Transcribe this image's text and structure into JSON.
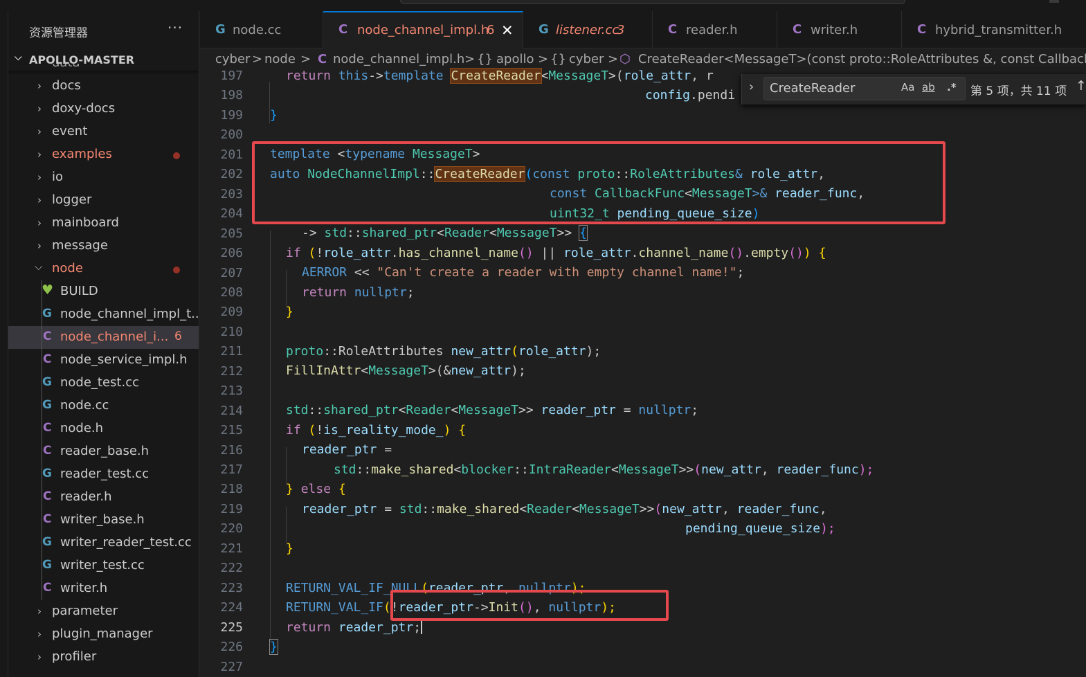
{
  "explorer": {
    "title": "资源管理器",
    "more": "···",
    "root": "APOLLO-MASTER",
    "partial_top": "data",
    "items": [
      {
        "label": "docs",
        "kind": "folder",
        "expanded": false
      },
      {
        "label": "doxy-docs",
        "kind": "folder",
        "expanded": false
      },
      {
        "label": "event",
        "kind": "folder",
        "expanded": false
      },
      {
        "label": "examples",
        "kind": "folder",
        "expanded": false,
        "modified": true
      },
      {
        "label": "io",
        "kind": "folder",
        "expanded": false
      },
      {
        "label": "logger",
        "kind": "folder",
        "expanded": false
      },
      {
        "label": "mainboard",
        "kind": "folder",
        "expanded": false
      },
      {
        "label": "message",
        "kind": "folder",
        "expanded": false
      },
      {
        "label": "node",
        "kind": "folder",
        "expanded": true,
        "modified": true
      }
    ],
    "node_files": [
      {
        "label": "BUILD",
        "icon": "heart"
      },
      {
        "label": "node_channel_impl_t...",
        "icon": "cpp"
      },
      {
        "label": "node_channel_i...",
        "icon": "c",
        "active": true,
        "badge": "6"
      },
      {
        "label": "node_service_impl.h",
        "icon": "c"
      },
      {
        "label": "node_test.cc",
        "icon": "cpp"
      },
      {
        "label": "node.cc",
        "icon": "cpp"
      },
      {
        "label": "node.h",
        "icon": "c"
      },
      {
        "label": "reader_base.h",
        "icon": "c"
      },
      {
        "label": "reader_test.cc",
        "icon": "cpp"
      },
      {
        "label": "reader.h",
        "icon": "c"
      },
      {
        "label": "writer_base.h",
        "icon": "c"
      },
      {
        "label": "writer_reader_test.cc",
        "icon": "cpp"
      },
      {
        "label": "writer_test.cc",
        "icon": "cpp"
      },
      {
        "label": "writer.h",
        "icon": "c"
      }
    ],
    "after_items": [
      {
        "label": "parameter"
      },
      {
        "label": "plugin_manager"
      },
      {
        "label": "profiler"
      }
    ]
  },
  "tabs": [
    {
      "label": "node.cc",
      "icon": "G"
    },
    {
      "label": "node_channel_impl.h",
      "icon": "C",
      "badge": "6",
      "active": true,
      "close": "✕"
    },
    {
      "label": "listener.cc",
      "icon": "G",
      "badge": "3"
    },
    {
      "label": "reader.h",
      "icon": "C"
    },
    {
      "label": "writer.h",
      "icon": "C"
    },
    {
      "label": "hybrid_transmitter.h",
      "icon": "C"
    }
  ],
  "breadcrumb": {
    "parts": [
      "cyber",
      "node",
      "node_channel_impl.h",
      "apollo",
      "cyber",
      "CreateReader<MessageT>(const proto::RoleAttributes &, const CallbackFun"
    ],
    "sep": ">",
    "ns_glyph": "{}",
    "c_glyph": "C"
  },
  "find": {
    "query": "CreateReader",
    "match_case": "Aa",
    "whole_word": "ab",
    "regex": ".*",
    "result": "第 5 项，共 11 项",
    "up": "↑",
    "toggle": "›"
  },
  "editor": {
    "line_numbers": [
      "197",
      "198",
      "199",
      "200",
      "201",
      "202",
      "203",
      "204",
      "205",
      "206",
      "207",
      "208",
      "209",
      "210",
      "211",
      "212",
      "213",
      "214",
      "215",
      "216",
      "217",
      "218",
      "219",
      "220",
      "221",
      "222",
      "223",
      "224",
      "225",
      "226",
      "227"
    ],
    "current_line": "225",
    "code": {
      "l197": [
        "return ",
        "this",
        "->",
        "template ",
        "CreateReader",
        "<",
        "MessageT",
        ">(",
        "role_attr",
        ", r"
      ],
      "l198": [
        "config",
        ".pendi"
      ],
      "l199": [
        "}"
      ],
      "l201": [
        "template ",
        "<",
        "typename ",
        "MessageT",
        ">"
      ],
      "l202": [
        "auto ",
        "NodeChannelImpl",
        "::",
        "CreateReader",
        "(",
        "const ",
        "proto",
        "::",
        "RoleAttributes",
        "& ",
        "role_attr",
        ","
      ],
      "l203": [
        "const ",
        "CallbackFunc",
        "<",
        "MessageT",
        ">& ",
        "reader_func",
        ","
      ],
      "l204": [
        "uint32_t ",
        "pending_queue_size",
        ")"
      ],
      "l205": [
        "-> ",
        "std",
        "::",
        "shared_ptr",
        "<",
        "Reader",
        "<",
        "MessageT",
        ">> ",
        "{"
      ],
      "l206": [
        "if ",
        "(",
        "!",
        "role_attr",
        ".",
        "has_channel_name",
        "()",
        " || ",
        "role_attr",
        ".",
        "channel_name",
        "()",
        ".",
        "empty",
        "()",
        ") ",
        "{"
      ],
      "l207": [
        "AERROR ",
        "<< ",
        "\"Can't create a reader with empty channel name!\"",
        ";"
      ],
      "l208": [
        "return ",
        "nullptr",
        ";"
      ],
      "l209": [
        "}"
      ],
      "l211": [
        "proto",
        "::",
        "RoleAttributes ",
        "new_attr",
        "(",
        "role_attr",
        ");"
      ],
      "l212": [
        "FillInAttr",
        "<",
        "MessageT",
        ">(",
        "&",
        "new_attr",
        ");"
      ],
      "l214": [
        "std",
        "::",
        "shared_ptr",
        "<",
        "Reader",
        "<",
        "MessageT",
        ">> ",
        "reader_ptr",
        " = ",
        "nullptr",
        ";"
      ],
      "l215": [
        "if ",
        "(",
        "!",
        "is_reality_mode_",
        ") ",
        "{"
      ],
      "l216": [
        "reader_ptr",
        " ="
      ],
      "l217": [
        "std",
        "::",
        "make_shared",
        "<",
        "blocker",
        "::",
        "IntraReader",
        "<",
        "MessageT",
        ">>",
        "(",
        "new_attr",
        ", ",
        "reader_func",
        ");"
      ],
      "l218": [
        "} ",
        "else ",
        "{"
      ],
      "l219": [
        "reader_ptr",
        " = ",
        "std",
        "::",
        "make_shared",
        "<",
        "Reader",
        "<",
        "MessageT",
        ">>",
        "(",
        "new_attr",
        ", ",
        "reader_func",
        ","
      ],
      "l220": [
        "pending_queue_size",
        ");"
      ],
      "l221": [
        "}"
      ],
      "l223": [
        "RETURN_VAL_IF_NULL",
        "(",
        "reader_ptr",
        ", ",
        "nullptr",
        ");"
      ],
      "l224": [
        "RETURN_VAL_IF",
        "(",
        "!",
        "reader_ptr",
        "->",
        "Init",
        "()",
        ", ",
        "nullptr",
        ");"
      ],
      "l225": [
        "return ",
        "reader_ptr",
        ";"
      ],
      "l226": [
        "}"
      ]
    }
  },
  "colors": {
    "accent": "#0078d4",
    "annotation": "#e5484d",
    "modified": "#f48771",
    "find_match": "#613214"
  }
}
